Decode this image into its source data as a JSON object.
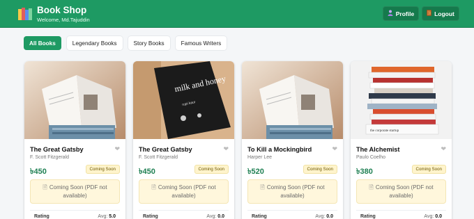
{
  "header": {
    "title": "Book Shop",
    "welcome": "Welcome, Md.Tajuddin",
    "profile_label": "Profile",
    "logout_label": "Logout",
    "color": "#1e9a63"
  },
  "tabs": [
    {
      "label": "All Books",
      "active": true
    },
    {
      "label": "Legendary Books",
      "active": false
    },
    {
      "label": "Story Books",
      "active": false
    },
    {
      "label": "Famous Writers",
      "active": false
    }
  ],
  "books": [
    {
      "title": "The Great Gatsby",
      "author": "F. Scott Fitzgerald",
      "price": "৳450",
      "badge": "Coming Soon",
      "notice": "Coming Soon (PDF not available)",
      "rating_label": "Rating",
      "avg_label": "Avg:",
      "avg_value": "5.0",
      "cover": "open-book"
    },
    {
      "title": "The Great Gatsby",
      "author": "F. Scott Fitzgerald",
      "price": "৳450",
      "badge": "Coming Soon",
      "notice": "Coming Soon (PDF not available)",
      "rating_label": "Rating",
      "avg_label": "Avg:",
      "avg_value": "0.0",
      "cover": "milk-and-honey",
      "cover_title": "milk and honey",
      "cover_author": "rupi kaur"
    },
    {
      "title": "To Kill a Mockingbird",
      "author": "Harper Lee",
      "price": "৳520",
      "badge": "Coming Soon",
      "notice": "Coming Soon (PDF not available)",
      "rating_label": "Rating",
      "avg_label": "Avg:",
      "avg_value": "0.0",
      "cover": "open-book"
    },
    {
      "title": "The Alchemist",
      "author": "Paulo Coelho",
      "price": "৳380",
      "badge": "Coming Soon",
      "notice": "Coming Soon (PDF not available)",
      "rating_label": "Rating",
      "avg_label": "Avg:",
      "avg_value": "0.0",
      "cover": "book-stack",
      "cover_text": "the corporate startup"
    }
  ]
}
